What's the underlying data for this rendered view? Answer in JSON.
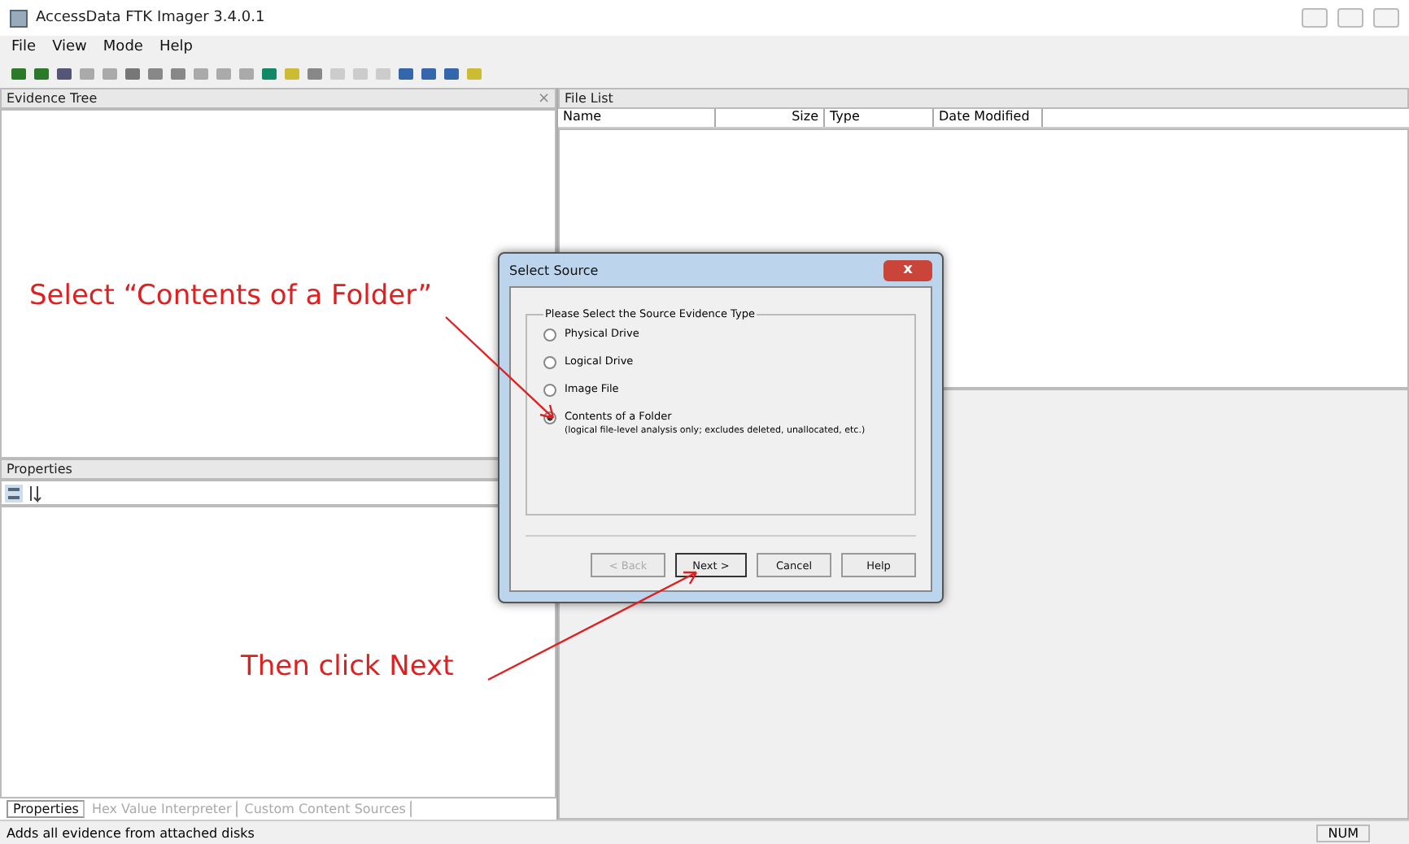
{
  "window": {
    "title": "AccessData FTK Imager 3.4.0.1"
  },
  "menu": [
    "File",
    "View",
    "Mode",
    "Help"
  ],
  "evidence_tree": {
    "title": "Evidence Tree",
    "close": "×"
  },
  "file_list": {
    "title": "File List",
    "columns": [
      "Name",
      "Size",
      "Type",
      "Date Modified"
    ]
  },
  "properties": {
    "title": "Properties"
  },
  "bottom_tabs": [
    {
      "label": "Properties",
      "selected": true
    },
    {
      "label": "Hex Value Interpreter",
      "selected": false
    },
    {
      "label": "Custom Content Sources",
      "selected": false
    }
  ],
  "status_bar": {
    "text": "Adds all evidence from attached disks",
    "indicator": "NUM"
  },
  "dialog": {
    "title": "Select Source",
    "close": "x",
    "group": "Please Select the Source Evidence Type",
    "options": [
      {
        "label": "Physical Drive",
        "selected": false
      },
      {
        "label": "Logical Drive",
        "selected": false
      },
      {
        "label": "Image File",
        "selected": false
      },
      {
        "label": "Contents of a Folder",
        "note": "(logical file-level analysis only; excludes deleted, unallocated, etc.)",
        "selected": true
      }
    ],
    "buttons": [
      {
        "label": "< Back",
        "disabled": true,
        "default": false
      },
      {
        "label": "Next >",
        "disabled": false,
        "default": true
      },
      {
        "label": "Cancel",
        "disabled": false,
        "default": false
      },
      {
        "label": "Help",
        "disabled": false,
        "default": false
      }
    ]
  },
  "annotations": [
    "Select “Contents of a Folder”",
    "Then click Next"
  ]
}
